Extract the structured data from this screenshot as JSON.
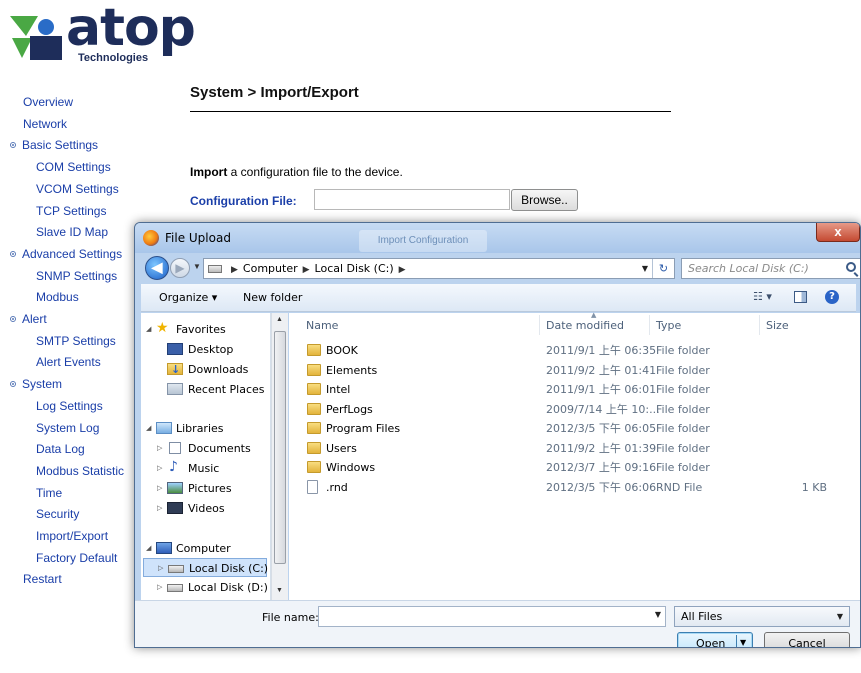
{
  "brand": {
    "name": "atop",
    "tagline": "Technologies"
  },
  "sidebar": {
    "items": [
      {
        "label": "Overview",
        "kind": "top"
      },
      {
        "label": "Network",
        "kind": "top"
      },
      {
        "label": "Basic Settings",
        "kind": "group"
      },
      {
        "label": "COM Settings",
        "kind": "sub"
      },
      {
        "label": "VCOM Settings",
        "kind": "sub"
      },
      {
        "label": "TCP Settings",
        "kind": "sub"
      },
      {
        "label": "Slave ID Map",
        "kind": "sub"
      },
      {
        "label": "Advanced Settings",
        "kind": "group"
      },
      {
        "label": "SNMP Settings",
        "kind": "sub"
      },
      {
        "label": "Modbus",
        "kind": "sub"
      },
      {
        "label": "Alert",
        "kind": "group"
      },
      {
        "label": "SMTP Settings",
        "kind": "sub"
      },
      {
        "label": "Alert Events",
        "kind": "sub"
      },
      {
        "label": "System",
        "kind": "group"
      },
      {
        "label": "Log Settings",
        "kind": "sub"
      },
      {
        "label": "System Log",
        "kind": "sub"
      },
      {
        "label": "Data Log",
        "kind": "sub"
      },
      {
        "label": "Modbus Statistic",
        "kind": "sub"
      },
      {
        "label": "Time",
        "kind": "sub"
      },
      {
        "label": "Security",
        "kind": "sub"
      },
      {
        "label": "Import/Export",
        "kind": "sub"
      },
      {
        "label": "Factory Default",
        "kind": "sub"
      },
      {
        "label": "Restart",
        "kind": "top"
      }
    ]
  },
  "main": {
    "title": "System > Import/Export",
    "import_bold": "Import",
    "import_rest": " a configuration file to the device.",
    "config_label": "Configuration File:",
    "config_value": "",
    "browse_label": "Browse..",
    "import_button_label": "Import Configuration"
  },
  "dialog": {
    "title": "File Upload",
    "close_label": "x",
    "breadcrumb": [
      "Computer",
      "Local Disk (C:)"
    ],
    "search_placeholder": "Search Local Disk (C:)",
    "toolbar": {
      "organize": "Organize ▾",
      "new_folder": "New folder"
    },
    "nav_tree": {
      "favorites": "Favorites",
      "desktop": "Desktop",
      "downloads": "Downloads",
      "recent": "Recent Places",
      "libraries": "Libraries",
      "documents": "Documents",
      "music": "Music",
      "pictures": "Pictures",
      "videos": "Videos",
      "computer": "Computer",
      "disk_c": "Local Disk (C:)",
      "disk_d": "Local Disk (D:)"
    },
    "columns": {
      "name": "Name",
      "date": "Date modified",
      "type": "Type",
      "size": "Size"
    },
    "files": [
      {
        "name": "BOOK",
        "date": "2011/9/1 上午 06:35",
        "type": "File folder",
        "size": ""
      },
      {
        "name": "Elements",
        "date": "2011/9/2 上午 01:41",
        "type": "File folder",
        "size": ""
      },
      {
        "name": "Intel",
        "date": "2011/9/1 上午 06:01",
        "type": "File folder",
        "size": ""
      },
      {
        "name": "PerfLogs",
        "date": "2009/7/14 上午 10:...",
        "type": "File folder",
        "size": ""
      },
      {
        "name": "Program Files",
        "date": "2012/3/5 下午 06:05",
        "type": "File folder",
        "size": ""
      },
      {
        "name": "Users",
        "date": "2011/9/2 上午 01:39",
        "type": "File folder",
        "size": ""
      },
      {
        "name": "Windows",
        "date": "2012/3/7 上午 09:16",
        "type": "File folder",
        "size": ""
      },
      {
        "name": ".rnd",
        "date": "2012/3/5 下午 06:06",
        "type": "RND File",
        "size": "1 KB"
      }
    ],
    "file_name_label": "File name:",
    "file_name_value": "",
    "file_type_selected": "All Files",
    "open_label": "Open",
    "cancel_label": "Cancel"
  }
}
